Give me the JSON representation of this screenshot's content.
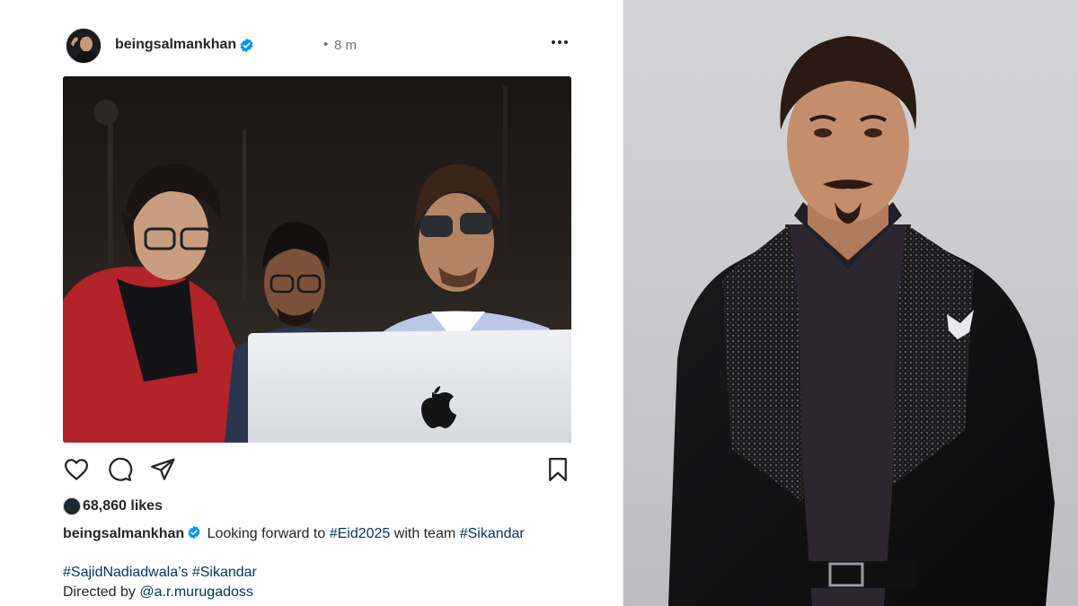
{
  "post": {
    "username": "beingsalmankhan",
    "time_separator": "•",
    "time_ago": "8 m",
    "likes": "68,860 likes",
    "caption": {
      "username": "beingsalmankhan",
      "text_1": "Looking forward to",
      "hashtag_1": "#Eid2025",
      "text_2": "with team",
      "hashtag_2": "#Sikandar"
    },
    "line_2": {
      "hashtag_1": "#SajidNadiadwala’s",
      "hashtag_2": "#Sikandar"
    },
    "line_3": {
      "text": "Directed by",
      "mention": "@a.r.murugadoss"
    }
  },
  "icons": {
    "more": "more-options-icon",
    "like": "heart-icon",
    "comment": "comment-icon",
    "share": "send-icon",
    "save": "bookmark-icon",
    "verified": "verified-badge-icon"
  },
  "colors": {
    "link": "#00376b",
    "verified": "#0095f6",
    "text": "#262626",
    "muted": "#737373"
  }
}
